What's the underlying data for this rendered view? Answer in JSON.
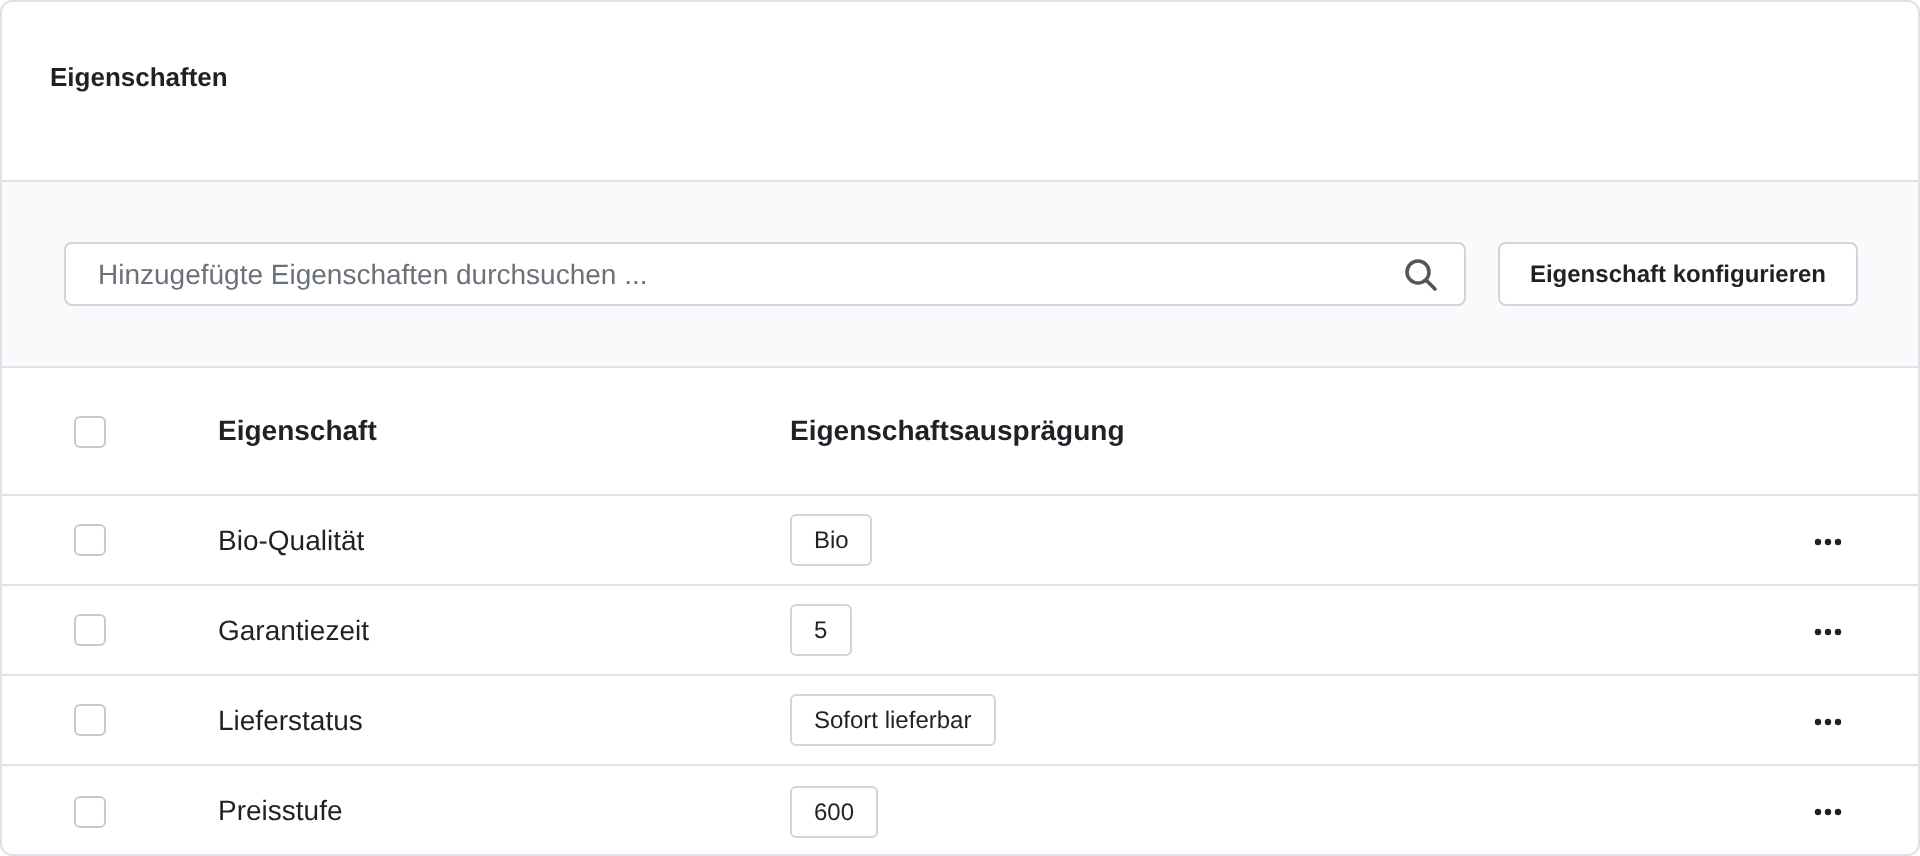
{
  "card": {
    "title": "Eigenschaften"
  },
  "toolbar": {
    "search": {
      "placeholder": "Hinzugefügte Eigenschaften durchsuchen ..."
    },
    "button": "Eigenschaft konfigurieren"
  },
  "table": {
    "select_all": {
      "checked": false
    },
    "columns": [
      "Eigenschaft",
      "Eigenschaftsausprägung"
    ],
    "rows": [
      {
        "checked": false,
        "name": "Bio-Qualität",
        "values": [
          "Bio"
        ]
      },
      {
        "checked": false,
        "name": "Garantiezeit",
        "values": [
          "5"
        ]
      },
      {
        "checked": false,
        "name": "Lieferstatus",
        "values": [
          "Sofort lieferbar"
        ]
      },
      {
        "checked": false,
        "name": "Preisstufe",
        "values": [
          "600"
        ]
      }
    ]
  }
}
